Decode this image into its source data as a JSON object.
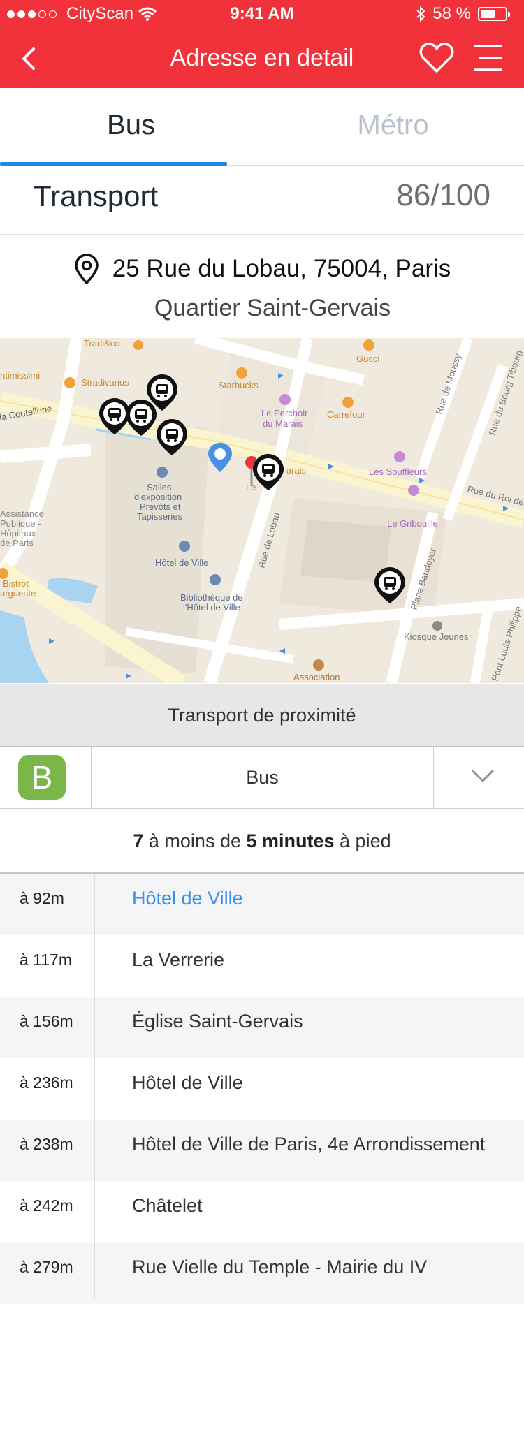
{
  "status": {
    "carrier": "CityScan",
    "time": "9:41 AM",
    "battery": "58 %"
  },
  "nav": {
    "title": "Adresse en detail"
  },
  "tabs": [
    {
      "label": "Bus",
      "active": true
    },
    {
      "label": "Métro",
      "active": false
    }
  ],
  "score": {
    "label": "Transport",
    "value": "86/100"
  },
  "address": {
    "line": "25 Rue du Lobau, 75004, Paris",
    "district": "Quartier Saint-Gervais"
  },
  "map": {
    "labels": {
      "tradi": "Tradi&co",
      "stradivarius": "Stradivarius",
      "timissimi": "ntimissimi",
      "coutellerie": "la Coutellerie",
      "starbucks": "Starbucks",
      "gucci": "Gucci",
      "perchoir": "Le Perchoir",
      "perchoir2": "du Marais",
      "carrefour": "Carrefour",
      "souffleurs": "Les Souffleurs",
      "gribouille": "Le Gribouille",
      "salles1": "Salles",
      "salles2": "d'exposition",
      "salles3": "Prevôts et",
      "salles4": "Tapisseries",
      "hotel": "Hôtel de Ville",
      "biblio1": "Bibliothèque de",
      "biblio2": "l'Hôtel de Ville",
      "assistance1": "Assistance",
      "assistance2": "Publique -",
      "assistance3": "Hôpitaux",
      "assistance4": "de Paris",
      "bistrot1": "Bistrot",
      "bistrot2": "arguerite",
      "kiosque": "Kiosque Jeunes",
      "association": "Association",
      "lobau": "Rue de Lobau",
      "baudoyer": "Place Baudoyer",
      "moussy": "Rue de Moussy",
      "bourg": "Rue du Bourg Tibourg",
      "roi": "Rue du Roi de",
      "louis": "Pont Louis-Philippe",
      "lemarais": "Le",
      "lemarais2": "arais"
    }
  },
  "proximity": {
    "title": "Transport de proximité"
  },
  "selector": {
    "badge": "B",
    "label": "Bus"
  },
  "summary": {
    "count": "7",
    "text1": " à moins de ",
    "minutes": "5 minutes",
    "text2": " à pied"
  },
  "stops": [
    {
      "distance": "à 92m",
      "name": "Hôtel de Ville",
      "highlight": true
    },
    {
      "distance": "à 117m",
      "name": "La Verrerie"
    },
    {
      "distance": "à 156m",
      "name": "Église Saint-Gervais"
    },
    {
      "distance": "à 236m",
      "name": "Hôtel de Ville"
    },
    {
      "distance": "à 238m",
      "name": "Hôtel de Ville de Paris, 4e Arrondissement"
    },
    {
      "distance": "à 242m",
      "name": "Châtelet"
    },
    {
      "distance": "à 279m",
      "name": "Rue Vielle du Temple - Mairie du IV"
    }
  ],
  "colors": {
    "brand_red": "#f1323a",
    "tab_indicator": "#1b87e6",
    "bus_badge": "#7ab648",
    "highlight_link": "#3d8ee6"
  }
}
